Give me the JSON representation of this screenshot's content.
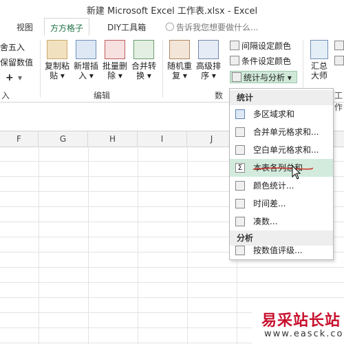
{
  "window": {
    "title": "新建 Microsoft Excel 工作表.xlsx - Excel"
  },
  "tabs": [
    {
      "label": "视图",
      "active": false
    },
    {
      "label": "方方格子",
      "active": true
    },
    {
      "label": "DIY工具箱",
      "active": false
    }
  ],
  "tell_me": {
    "placeholder": "告诉我您想要做什么..."
  },
  "ribbon": {
    "left_partial": {
      "round_label": "舍五入",
      "keep_value_label": "保留数值",
      "plus_label": "+",
      "group_label": "入"
    },
    "edit_group": {
      "label": "编辑",
      "buttons": [
        {
          "label1": "复制粘",
          "label2": "贴"
        },
        {
          "label1": "新增插",
          "label2": "入"
        },
        {
          "label1": "批量删",
          "label2": "除"
        },
        {
          "label1": "合并转",
          "label2": "换"
        }
      ]
    },
    "data_group": {
      "label": "数",
      "buttons": [
        {
          "label1": "随机重",
          "label2": "复"
        },
        {
          "label1": "高级排",
          "label2": "序"
        }
      ],
      "small": [
        {
          "label": "间隔设定颜色"
        },
        {
          "label": "条件设定颜色"
        },
        {
          "label": "统计与分析"
        }
      ]
    },
    "right_partial": {
      "summary_label1": "汇总",
      "summary_label2": "大师",
      "work_label": "工作"
    }
  },
  "columns": [
    "F",
    "G",
    "H",
    "I",
    "J"
  ],
  "dropdown": {
    "section_stats": "统计",
    "section_analysis": "分析",
    "items_stats": [
      {
        "label": "多区域求和",
        "icon": "table-icon"
      },
      {
        "label": "合并单元格求和...",
        "icon": "merge-sum-icon"
      },
      {
        "label": "空白单元格求和...",
        "icon": "blank-sum-icon"
      },
      {
        "label": "本表各列总和",
        "icon": "sigma-icon"
      },
      {
        "label": "颜色统计...",
        "icon": "color-stats-icon"
      },
      {
        "label": "时间差...",
        "icon": "time-diff-icon"
      },
      {
        "label": "凑数...",
        "icon": "make-number-icon"
      }
    ],
    "items_analysis": [
      {
        "label": "按数值评级...",
        "icon": "rating-icon"
      }
    ]
  },
  "watermark": {
    "title": "易采站长站",
    "url": "www.easck.com"
  },
  "colors": {
    "accent": "#217346",
    "hover": "#d3ebdc",
    "highlight": "#cfe8d8",
    "underline": "#d0342c"
  }
}
